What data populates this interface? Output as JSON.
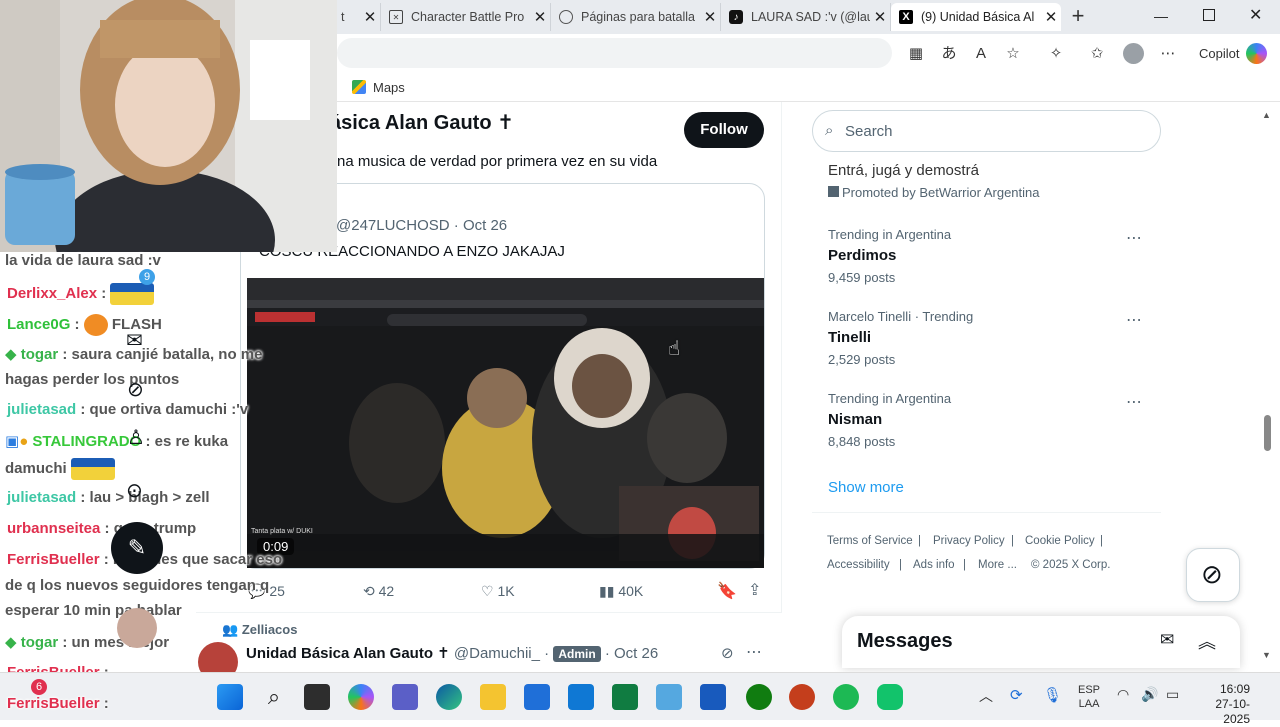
{
  "browser": {
    "tabs": [
      {
        "title": "t",
        "active": false
      },
      {
        "title": "Character Battle Pro",
        "active": false
      },
      {
        "title": "Páginas para batalla",
        "active": false
      },
      {
        "title": "LAURA SAD :'v (@lau",
        "active": false
      },
      {
        "title": "(9) Unidad Básica Al",
        "active": true
      }
    ],
    "new_tab": "+",
    "copilot_label": "Copilot",
    "bookmark_maps": "Maps"
  },
  "profile": {
    "name_fragment": "ásica Alan Gauto ✝",
    "follow_label": "Follow",
    "tweet_text_fragment": "na musica de verdad por primera vez en su vida"
  },
  "quote": {
    "handle": "@247LUCHOSD",
    "sep": "·",
    "date": "Oct 26",
    "text": "COSCU REACCIONANDO A ENZO JAKAJAJ",
    "video_time": "0:09",
    "video_caption_left": "Tanta plata w/ DUKI"
  },
  "actions": {
    "replies": "25",
    "retweets": "42",
    "likes": "1K",
    "views": "40K"
  },
  "next_tweet": {
    "context": "Zelliacos",
    "name": "Unidad Básica Alan Gauto ✝",
    "handle": "@Damuchii_",
    "badge": "Admin",
    "date": "Oct 26"
  },
  "sidebar": {
    "search_placeholder": "Search",
    "promo_title": "Entrá, jugá y demostrá",
    "promo_by": "Promoted by BetWarrior Argentina",
    "trends": [
      {
        "context": "Trending in Argentina",
        "name": "Perdimos",
        "count": "9,459 posts"
      },
      {
        "context": "Marcelo Tinelli · Trending",
        "name": "Tinelli",
        "count": "2,529 posts"
      },
      {
        "context": "Trending in Argentina",
        "name": "Nisman",
        "count": "8,848 posts"
      }
    ],
    "show_more": "Show more",
    "footer": {
      "terms": "Terms of Service",
      "privacy": "Privacy Policy",
      "cookie": "Cookie Policy",
      "accessibility": "Accessibility",
      "ads": "Ads info",
      "more": "More ...",
      "copyright": "© 2025 X Corp."
    },
    "messages_title": "Messages"
  },
  "stream_chat": [
    {
      "user": "",
      "color": "#555555",
      "text": "la vida de laura sad :v"
    },
    {
      "user": "Derlixx_Alex",
      "color": "#e0304f",
      "text": ":"
    },
    {
      "user": "Lance0G",
      "color": "#2fc13a",
      "text": ":"
    },
    {
      "user": "togar",
      "color": "#37b34a",
      "text": ": saura canjié batalla, no me"
    },
    {
      "user": "",
      "color": "#555555",
      "text": "hagas perder los puntos"
    },
    {
      "user": "julietasad",
      "color": "#3ec7a5",
      "text": ": que ortiva damuchi :'v"
    },
    {
      "user": "STALINGRADO",
      "color": "#37c83a",
      "text": ": es re kuka"
    },
    {
      "user": "",
      "color": "#555555",
      "text": "damuchi"
    },
    {
      "user": "julietasad",
      "color": "#3ec7a5",
      "text": ": lau > blagh > zell"
    },
    {
      "user": "urbannseitea",
      "color": "#e0304f",
      "text": ": gano trump"
    },
    {
      "user": "FerrisBueller",
      "color": "#e0304f",
      "text": ": lau tenes que sacar eso"
    },
    {
      "user": "",
      "color": "#555555",
      "text": "de q los nuevos seguidores tengan q"
    },
    {
      "user": "",
      "color": "#555555",
      "text": "esperar 10 min pa hablar"
    },
    {
      "user": "togar",
      "color": "#37b34a",
      "text": ": un mes mejor"
    },
    {
      "user": "FerrisBueller",
      "color": "#e0304f",
      "text": ":"
    },
    {
      "user": "FerrisBueller",
      "color": "#e0304f",
      "text": ":"
    }
  ],
  "stream_badges": {
    "derlixx": "9",
    "flash": "FLASH",
    "ferris": "6"
  },
  "taskbar": {
    "lang1": "ESP",
    "lang2": "LAA",
    "time": "16:09",
    "date": "27-10-2025"
  }
}
